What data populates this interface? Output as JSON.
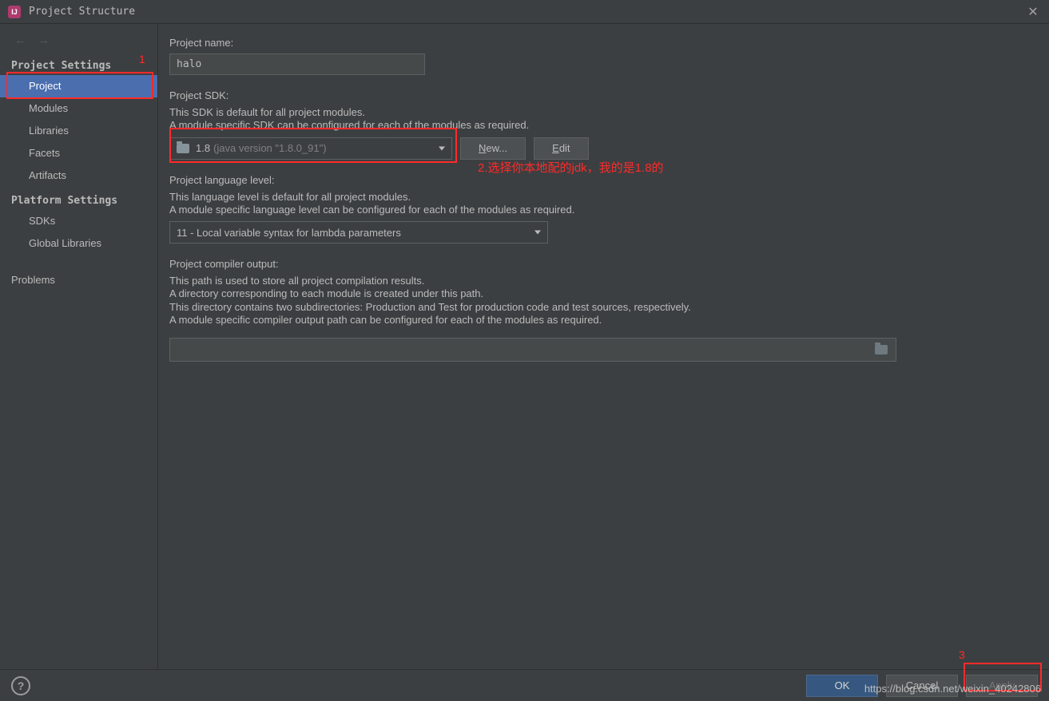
{
  "window": {
    "title": "Project Structure",
    "close_glyph": "✕"
  },
  "sidebar": {
    "section1_label": "Project Settings",
    "section2_label": "Platform Settings",
    "items1": [
      "Project",
      "Modules",
      "Libraries",
      "Facets",
      "Artifacts"
    ],
    "items2": [
      "SDKs",
      "Global Libraries"
    ],
    "problems_label": "Problems"
  },
  "main": {
    "project_name_label": "Project name:",
    "project_name_value": "halo",
    "sdk_label": "Project SDK:",
    "sdk_desc1": "This SDK is default for all project modules.",
    "sdk_desc2": "A module specific SDK can be configured for each of the modules as required.",
    "sdk_value_main": "1.8",
    "sdk_value_ver": "(java version \"1.8.0_91\")",
    "new_label": "New...",
    "edit_label": "Edit",
    "lang_label": "Project language level:",
    "lang_desc1": "This language level is default for all project modules.",
    "lang_desc2": "A module specific language level can be configured for each of the modules as required.",
    "lang_value": "11 - Local variable syntax for lambda parameters",
    "out_label": "Project compiler output:",
    "out_desc1": "This path is used to store all project compilation results.",
    "out_desc2": "A directory corresponding to each module is created under this path.",
    "out_desc3": "This directory contains two subdirectories: Production and Test for production code and test sources, respectively.",
    "out_desc4": "A module specific compiler output path can be configured for each of the modules as required.",
    "out_value": ""
  },
  "annotations": {
    "n1": "1",
    "n2": "2.选择你本地配的jdk，我的是1.8的",
    "n3": "3"
  },
  "buttons": {
    "ok": "OK",
    "cancel": "Cancel",
    "apply": "Apply"
  },
  "watermark": "https://blog.csdn.net/weixin_40242806"
}
